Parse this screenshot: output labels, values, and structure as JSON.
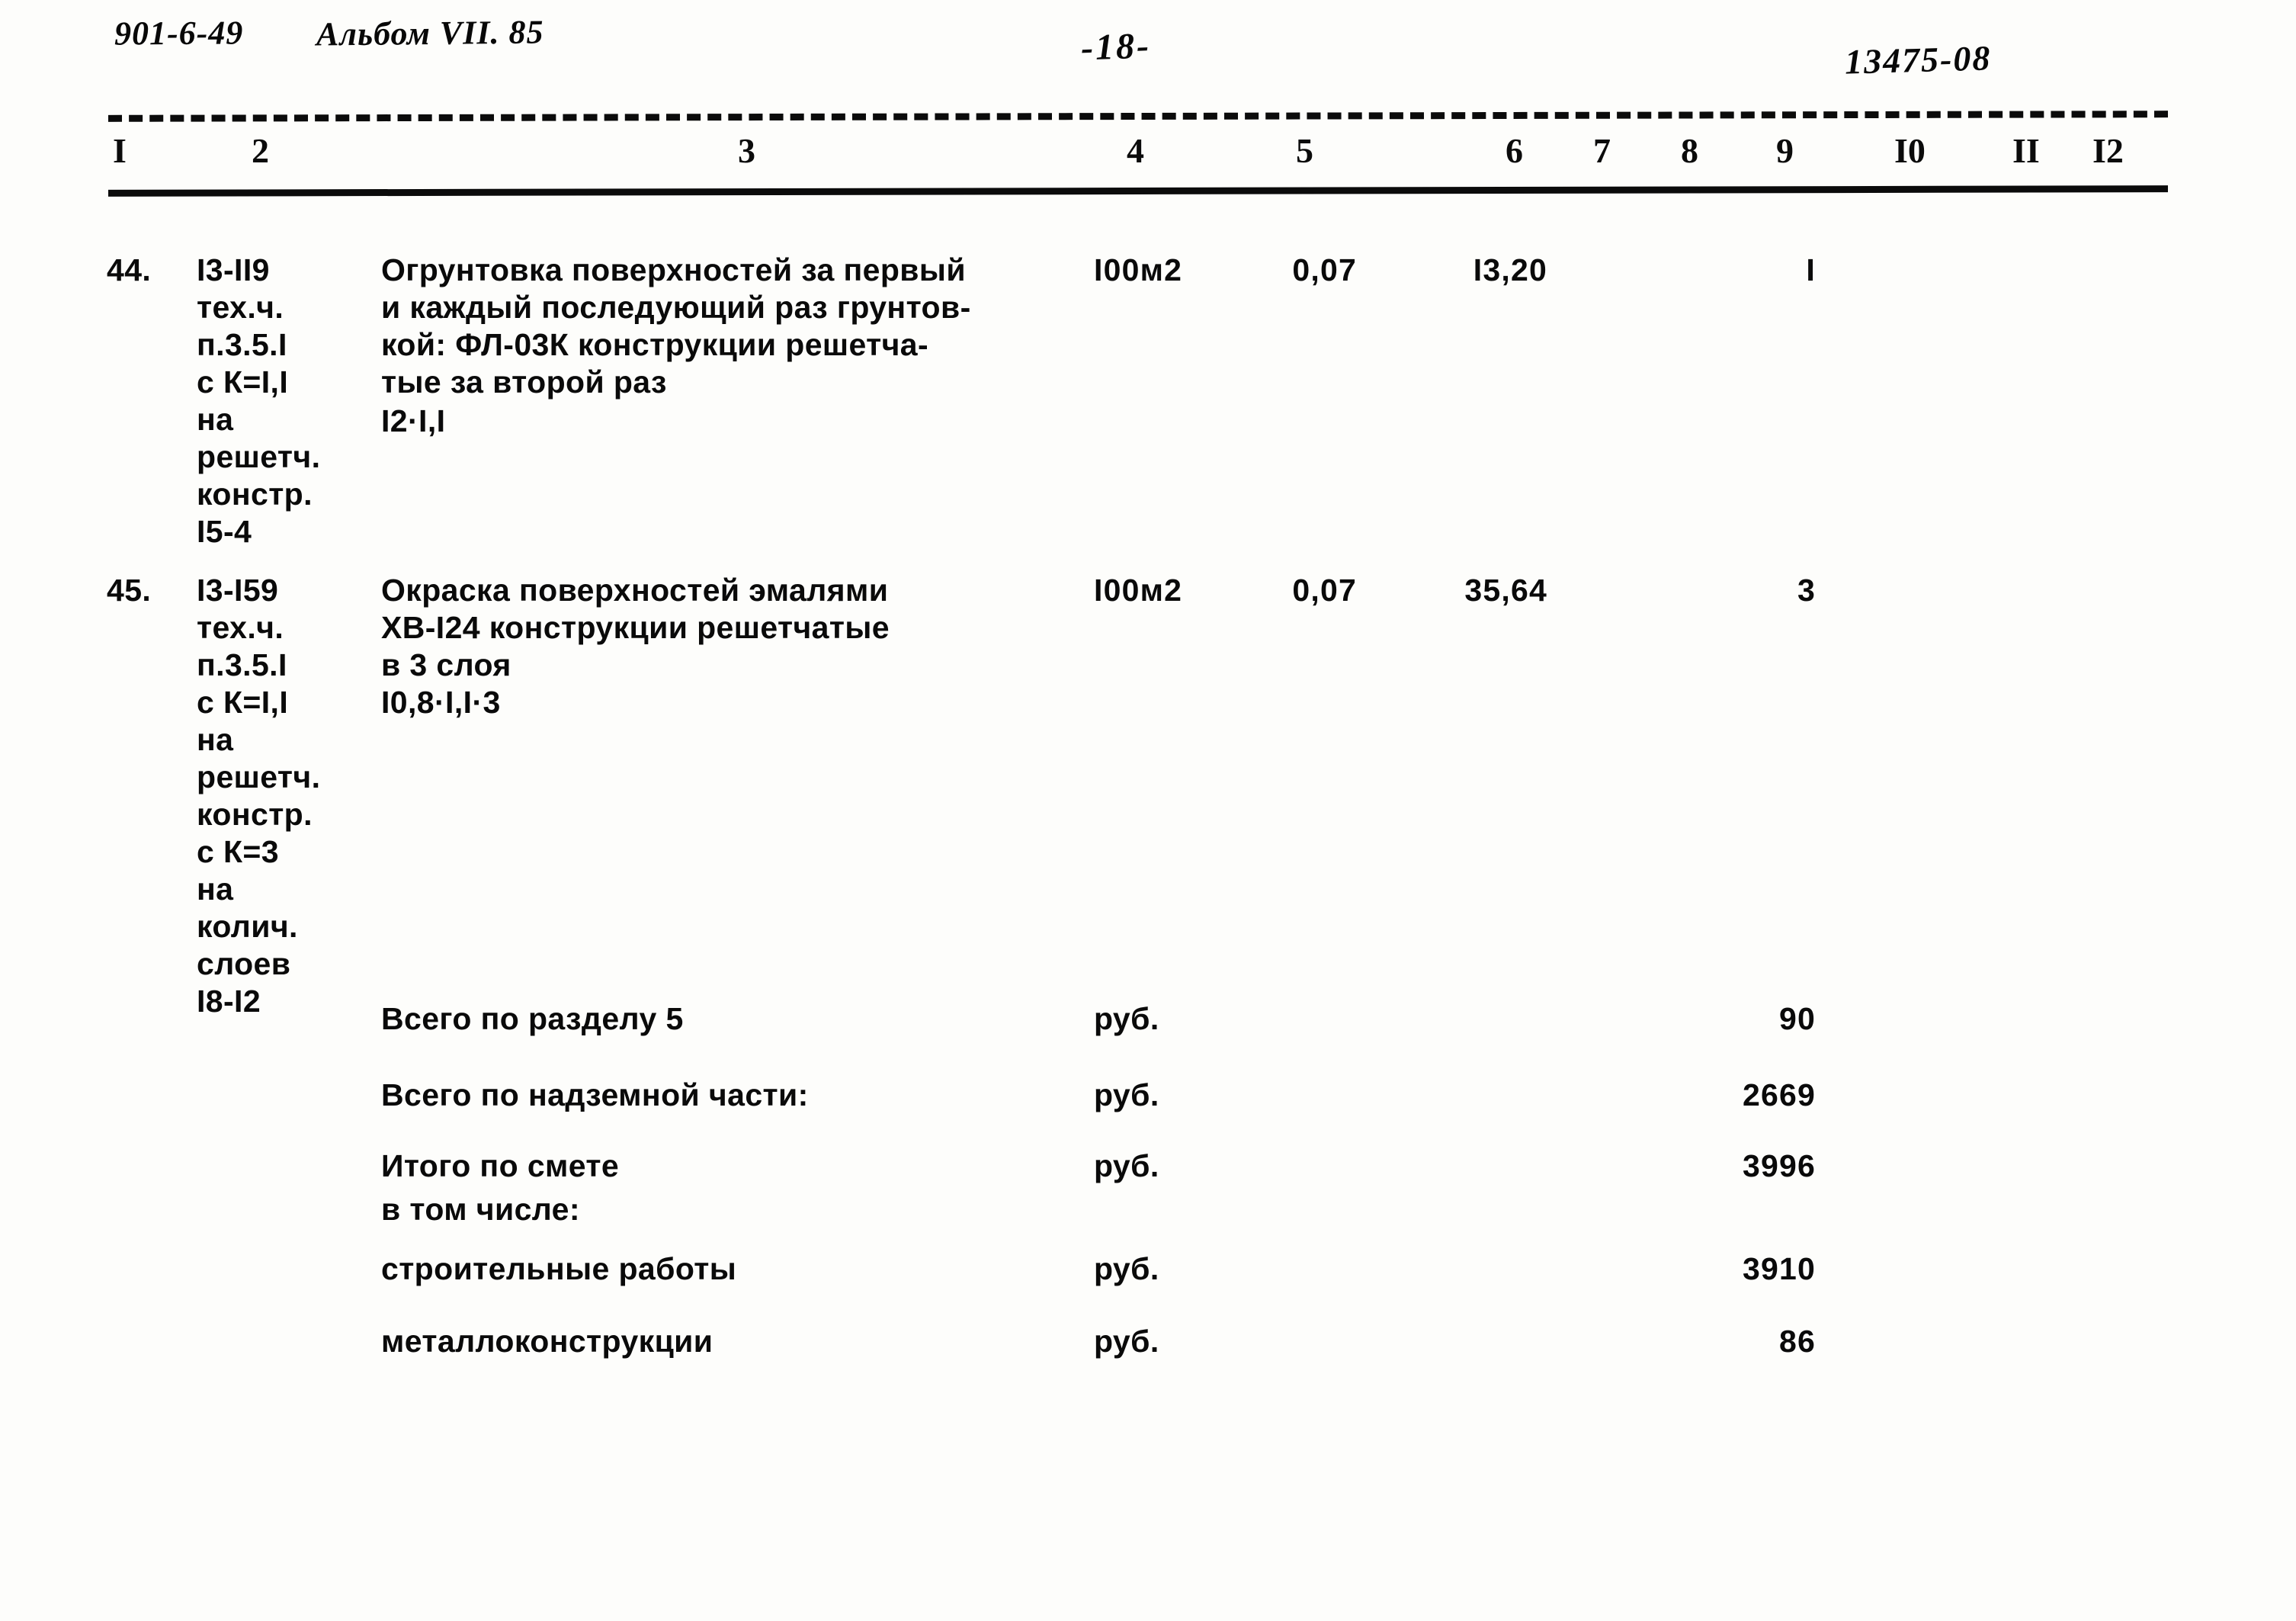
{
  "header": {
    "document_code": "901-6-49",
    "album": "Альбом VII. 85",
    "page_number": "-18-",
    "stamp": "13475-08"
  },
  "table": {
    "column_numbers": [
      "I",
      "2",
      "3",
      "4",
      "5",
      "6",
      "7",
      "8",
      "9",
      "I0",
      "II",
      "I2"
    ],
    "rows": [
      {
        "no": "44.",
        "justification": "I3-II9\nтех.ч.\nп.3.5.I\nс К=I,I\nна\nрешетч.\nконстр.\nI5-4",
        "description": "Огрунтовка поверхностей за первый\nи каждый последующий раз грунтов-\nкой: ФЛ-03К конструкции решетча-\nтые за второй раз",
        "formula": "I2·I,I",
        "unit": "I00м2",
        "col5": "0,07",
        "col6": "I3,20",
        "col7": "",
        "col8": "",
        "col9": "I",
        "col10": "",
        "col11": "",
        "col12": ""
      },
      {
        "no": "45.",
        "justification": "I3-I59\nтех.ч.\nп.3.5.I\nс К=I,I\nна\nрешетч.\nконстр.\nс К=3\nна\nколич.\nслоев\nI8-I2",
        "description": "Окраска поверхностей эмалями\nХВ-I24 конструкции решетчатые\nв 3 слоя",
        "formula": "I0,8·I,I·3",
        "unit": "I00м2",
        "col5": "0,07",
        "col6": "35,64",
        "col7": "",
        "col8": "",
        "col9": "3",
        "col10": "",
        "col11": "",
        "col12": ""
      }
    ],
    "totals": [
      {
        "label": "Всего по разделу 5",
        "unit": "руб.",
        "value": "90"
      },
      {
        "label": "Всего по надземной части:",
        "unit": "руб.",
        "value": "2669"
      },
      {
        "label": "Итого по смете",
        "unit": "руб.",
        "value": "3996"
      },
      {
        "label": "в том числе:",
        "unit": "",
        "value": ""
      },
      {
        "label": "строительные работы",
        "unit": "руб.",
        "value": "3910"
      },
      {
        "label": "металлоконструкции",
        "unit": "руб.",
        "value": "86"
      }
    ]
  }
}
